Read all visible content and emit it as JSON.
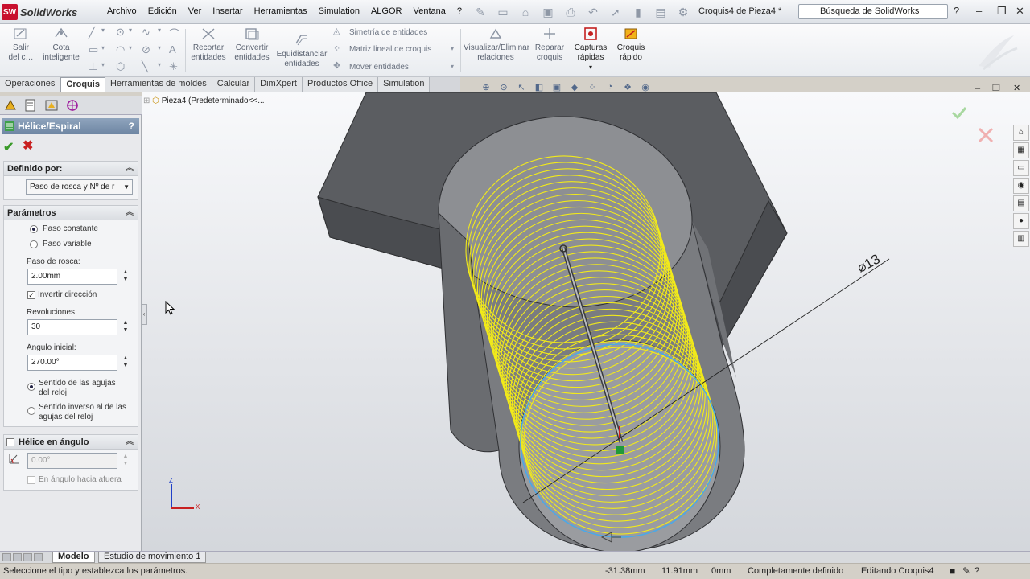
{
  "app": {
    "name": "SolidWorks",
    "logo": "SW"
  },
  "menus": [
    "Archivo",
    "Edición",
    "Ver",
    "Insertar",
    "Herramientas",
    "Simulation",
    "ALGOR",
    "Ventana",
    "?"
  ],
  "document_title": "Croquis4 de Pieza4 *",
  "search": {
    "value": "Búsqueda de SolidWorks"
  },
  "command_manager": {
    "exit_sketch": "Salir\ndel c…",
    "smart_dimension": "Cota\ninteligente",
    "trim": "Recortar\nentidades",
    "convert": "Convertir\nentidades",
    "offset": "Equidistanciar\nentidades",
    "mirror": "Simetría de entidades",
    "linear_pattern": "Matriz lineal de croquis",
    "move": "Mover entidades",
    "relations": "Visualizar/Eliminar\nrelaciones",
    "repair": "Reparar\ncroquis",
    "quick_snaps": "Capturas\nrápidas",
    "rapid_sketch": "Croquis\nrápido"
  },
  "cm_tabs": [
    "Operaciones",
    "Croquis",
    "Herramientas de moldes",
    "Calcular",
    "DimXpert",
    "Productos Office",
    "Simulation"
  ],
  "active_cm_tab": "Croquis",
  "property_manager": {
    "title": "Hélice/Espiral",
    "help": "?",
    "defined_by": {
      "header": "Definido por:",
      "selected": "Paso de rosca y Nº de r"
    },
    "parameters": {
      "header": "Parámetros",
      "pitch_constant": "Paso constante",
      "pitch_variable": "Paso variable",
      "pitch_label": "Paso de rosca:",
      "pitch_value": "2.00mm",
      "reverse_direction": "Invertir dirección",
      "revolutions_label": "Revoluciones",
      "revolutions_value": "30",
      "start_angle_label": "Ángulo inicial:",
      "start_angle_value": "270.00°",
      "clockwise": "Sentido de las agujas del reloj",
      "counterclockwise": "Sentido inverso al de las agujas del reloj"
    },
    "taper": {
      "header": "Hélice en ángulo",
      "angle_value": "0.00°",
      "taper_outward": "En ángulo hacia afuera"
    }
  },
  "feature_tree": {
    "item": "Pieza4  (Predeterminado<<..."
  },
  "viewport": {
    "dimension": "⌀13",
    "helix_color": "#f2ea1a"
  },
  "bottom_tabs": [
    "Modelo",
    "Estudio de movimiento 1"
  ],
  "active_bottom_tab": "Modelo",
  "status": {
    "message": "Seleccione el tipo y establezca los parámetros.",
    "x": "-31.38mm",
    "y": "11.91mm",
    "z": "0mm",
    "state": "Completamente definido",
    "editing": "Editando Croquis4"
  }
}
